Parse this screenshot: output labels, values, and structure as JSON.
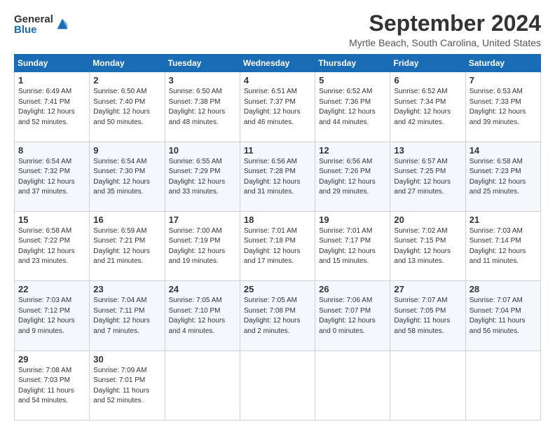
{
  "logo": {
    "general": "General",
    "blue": "Blue"
  },
  "title": "September 2024",
  "location": "Myrtle Beach, South Carolina, United States",
  "days_of_week": [
    "Sunday",
    "Monday",
    "Tuesday",
    "Wednesday",
    "Thursday",
    "Friday",
    "Saturday"
  ],
  "weeks": [
    [
      {
        "day": "1",
        "sunrise": "6:49 AM",
        "sunset": "7:41 PM",
        "daylight": "12 hours and 52 minutes"
      },
      {
        "day": "2",
        "sunrise": "6:50 AM",
        "sunset": "7:40 PM",
        "daylight": "12 hours and 50 minutes"
      },
      {
        "day": "3",
        "sunrise": "6:50 AM",
        "sunset": "7:38 PM",
        "daylight": "12 hours and 48 minutes"
      },
      {
        "day": "4",
        "sunrise": "6:51 AM",
        "sunset": "7:37 PM",
        "daylight": "12 hours and 46 minutes"
      },
      {
        "day": "5",
        "sunrise": "6:52 AM",
        "sunset": "7:36 PM",
        "daylight": "12 hours and 44 minutes"
      },
      {
        "day": "6",
        "sunrise": "6:52 AM",
        "sunset": "7:34 PM",
        "daylight": "12 hours and 42 minutes"
      },
      {
        "day": "7",
        "sunrise": "6:53 AM",
        "sunset": "7:33 PM",
        "daylight": "12 hours and 39 minutes"
      }
    ],
    [
      {
        "day": "8",
        "sunrise": "6:54 AM",
        "sunset": "7:32 PM",
        "daylight": "12 hours and 37 minutes"
      },
      {
        "day": "9",
        "sunrise": "6:54 AM",
        "sunset": "7:30 PM",
        "daylight": "12 hours and 35 minutes"
      },
      {
        "day": "10",
        "sunrise": "6:55 AM",
        "sunset": "7:29 PM",
        "daylight": "12 hours and 33 minutes"
      },
      {
        "day": "11",
        "sunrise": "6:56 AM",
        "sunset": "7:28 PM",
        "daylight": "12 hours and 31 minutes"
      },
      {
        "day": "12",
        "sunrise": "6:56 AM",
        "sunset": "7:26 PM",
        "daylight": "12 hours and 29 minutes"
      },
      {
        "day": "13",
        "sunrise": "6:57 AM",
        "sunset": "7:25 PM",
        "daylight": "12 hours and 27 minutes"
      },
      {
        "day": "14",
        "sunrise": "6:58 AM",
        "sunset": "7:23 PM",
        "daylight": "12 hours and 25 minutes"
      }
    ],
    [
      {
        "day": "15",
        "sunrise": "6:58 AM",
        "sunset": "7:22 PM",
        "daylight": "12 hours and 23 minutes"
      },
      {
        "day": "16",
        "sunrise": "6:59 AM",
        "sunset": "7:21 PM",
        "daylight": "12 hours and 21 minutes"
      },
      {
        "day": "17",
        "sunrise": "7:00 AM",
        "sunset": "7:19 PM",
        "daylight": "12 hours and 19 minutes"
      },
      {
        "day": "18",
        "sunrise": "7:01 AM",
        "sunset": "7:18 PM",
        "daylight": "12 hours and 17 minutes"
      },
      {
        "day": "19",
        "sunrise": "7:01 AM",
        "sunset": "7:17 PM",
        "daylight": "12 hours and 15 minutes"
      },
      {
        "day": "20",
        "sunrise": "7:02 AM",
        "sunset": "7:15 PM",
        "daylight": "12 hours and 13 minutes"
      },
      {
        "day": "21",
        "sunrise": "7:03 AM",
        "sunset": "7:14 PM",
        "daylight": "12 hours and 11 minutes"
      }
    ],
    [
      {
        "day": "22",
        "sunrise": "7:03 AM",
        "sunset": "7:12 PM",
        "daylight": "12 hours and 9 minutes"
      },
      {
        "day": "23",
        "sunrise": "7:04 AM",
        "sunset": "7:11 PM",
        "daylight": "12 hours and 7 minutes"
      },
      {
        "day": "24",
        "sunrise": "7:05 AM",
        "sunset": "7:10 PM",
        "daylight": "12 hours and 4 minutes"
      },
      {
        "day": "25",
        "sunrise": "7:05 AM",
        "sunset": "7:08 PM",
        "daylight": "12 hours and 2 minutes"
      },
      {
        "day": "26",
        "sunrise": "7:06 AM",
        "sunset": "7:07 PM",
        "daylight": "12 hours and 0 minutes"
      },
      {
        "day": "27",
        "sunrise": "7:07 AM",
        "sunset": "7:05 PM",
        "daylight": "11 hours and 58 minutes"
      },
      {
        "day": "28",
        "sunrise": "7:07 AM",
        "sunset": "7:04 PM",
        "daylight": "11 hours and 56 minutes"
      }
    ],
    [
      {
        "day": "29",
        "sunrise": "7:08 AM",
        "sunset": "7:03 PM",
        "daylight": "11 hours and 54 minutes"
      },
      {
        "day": "30",
        "sunrise": "7:09 AM",
        "sunset": "7:01 PM",
        "daylight": "11 hours and 52 minutes"
      },
      null,
      null,
      null,
      null,
      null
    ]
  ]
}
